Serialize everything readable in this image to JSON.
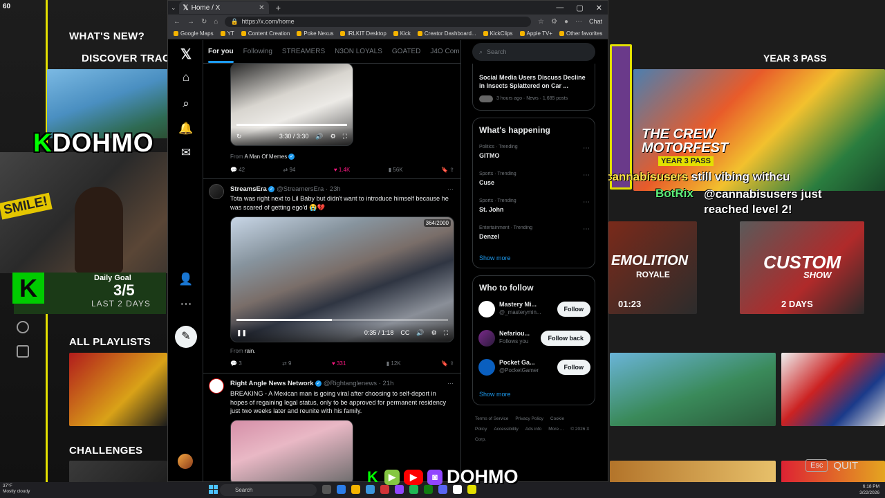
{
  "overlay": {
    "fps": "60",
    "whats_new": "WHAT'S NEW?",
    "discover": "DISCOVER TRACKP",
    "kdohmo": "DOHMO",
    "kdohmo_k": "K",
    "smile": "SMILE!",
    "daily_goal_label": "Daily Goal",
    "daily_goal_value": "3/5",
    "last_days": "LAST 2 DAYS",
    "all_playlists": "ALL PLAYLISTS",
    "challenges": "CHALLENGES",
    "year3": "YEAR 3 PASS",
    "motorfest_title": "THE CREW MOTORFEST",
    "year3_badge": "YEAR 3 PASS",
    "chat1_user": "cannabisusers",
    "chat1_msg": "still vibing withcu",
    "chat2_user": "BotRix",
    "chat2_msg": "@cannabisusers just reached level 2!",
    "demolition": "EMOLITION",
    "royale": "ROYALE",
    "timer1": "01:23",
    "custom": "CUSTOM",
    "show": "SHOW",
    "days2": "2 DAYS",
    "esc": "Esc",
    "quit": "QUIT",
    "bottom_brand": "DOHMO",
    "colors": {
      "accent_yellow": "#e3e000",
      "green": "#00cc00"
    }
  },
  "browser": {
    "tab_title": "Home / X",
    "url": "https://x.com/home",
    "chat_label": "Chat",
    "bookmarks": [
      "Google Maps",
      "YT",
      "Content Creation",
      "Poke Nexus",
      "IRLKIT Desktop",
      "Kick",
      "Creator Dashboard...",
      "KickClips",
      "Apple TV+"
    ],
    "other_favorites": "Other favorites"
  },
  "x": {
    "tabs": [
      "For you",
      "Following",
      "STREAMERS",
      "N3ON LOYALS",
      "GOATED",
      "J4O Com"
    ],
    "post1": {
      "video_time": "3:30 / 3:30",
      "from_label": "From",
      "from_name": "A Man Of Memes",
      "replies": "42",
      "reposts": "94",
      "likes": "1.4K",
      "views": "56K"
    },
    "post2": {
      "name": "StreamsEra",
      "handle": "@StreamersEra · 23h",
      "text": "Tota was right next to Lil Baby but didn't want to introduce himself because he was scared of getting ego'd 😭💔",
      "counter": "364/2000",
      "video_time": "0:35 / 1:18",
      "from_label": "From",
      "from_name": "rain.",
      "replies": "3",
      "reposts": "9",
      "likes": "331",
      "views": "12K",
      "progress": 0.45
    },
    "post3": {
      "name": "Right Angle News Network",
      "handle": "@Rightanglenews · 21h",
      "text": "BREAKING - A Mexican man is going viral after choosing to self-deport in hopes of regaining legal status, only to be approved for permanent residency just two weeks later and reunite with his family."
    },
    "search_placeholder": "Search",
    "top_story": {
      "title": "Social Media Users Discuss Decline in Insects Splattered on Car ...",
      "meta": "3 hours ago · News · 1,685 posts"
    },
    "whats_happening": "What's happening",
    "trends": [
      {
        "meta": "Politics · Trending",
        "topic": "GITMO"
      },
      {
        "meta": "Sports · Trending",
        "topic": "Cuse"
      },
      {
        "meta": "Sports · Trending",
        "topic": "St. John"
      },
      {
        "meta": "Entertainment · Trending",
        "topic": "Denzel"
      }
    ],
    "show_more": "Show more",
    "who_to_follow": "Who to follow",
    "follow_suggestions": [
      {
        "name": "Mastery Mi...",
        "handle": "@_masterymin...",
        "button": "Follow"
      },
      {
        "name": "Nefariou...",
        "handle": "Follows you",
        "button": "Follow back"
      },
      {
        "name": "Pocket Ga...",
        "handle": "@PocketGamer",
        "button": "Follow"
      }
    ],
    "footer": [
      "Terms of Service",
      "Privacy Policy",
      "Cookie Policy",
      "Accessibility",
      "Ads info",
      "More ...",
      "© 2026 X Corp."
    ]
  },
  "taskbar": {
    "weather_temp": "37°F",
    "weather_desc": "Mostly cloudy",
    "search": "Search",
    "time": "6:18 PM",
    "date": "3/22/2026"
  }
}
